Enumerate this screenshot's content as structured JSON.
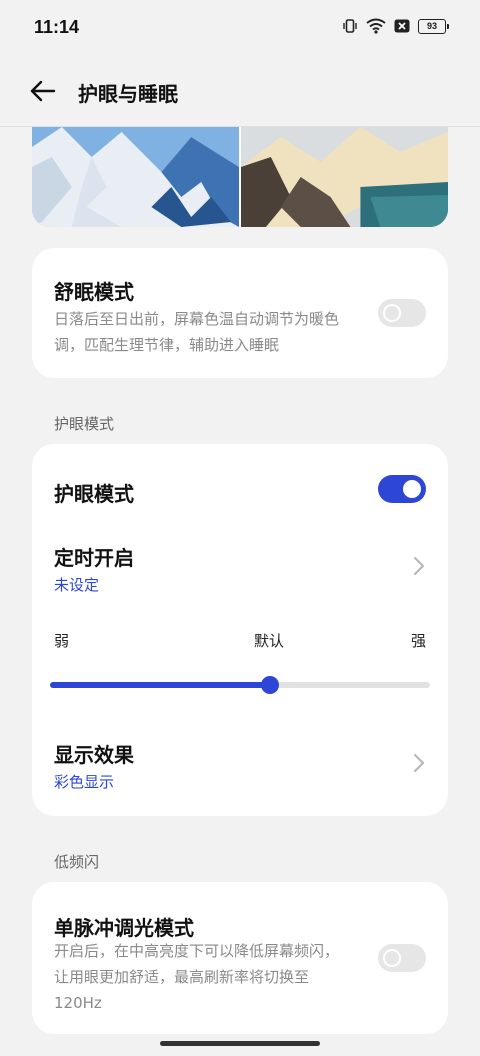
{
  "status_bar": {
    "time": "11:14",
    "battery": "93"
  },
  "header": {
    "title": "护眼与睡眠"
  },
  "sleep_card": {
    "title": "舒眠模式",
    "description_line1": "日落后至日出前，屏幕色温自动调节为暖色",
    "description_line2": "调，匹配生理节律，辅助进入睡眠",
    "toggle_on": false
  },
  "eye_section": {
    "label": "护眼模式",
    "eye_mode": {
      "title": "护眼模式",
      "toggle_on": true
    },
    "schedule": {
      "title": "定时开启",
      "value": "未设定"
    },
    "slider": {
      "min_label": "弱",
      "mid_label": "默认",
      "max_label": "强",
      "level_fraction": 0.58
    },
    "display": {
      "title": "显示效果",
      "value": "彩色显示"
    }
  },
  "flicker_section": {
    "label": "低频闪",
    "pulse_mode": {
      "title": "单脉冲调光模式",
      "description_line1": "开启后，在中高亮度下可以降低屏幕频闪，",
      "description_line2": "让用眼更加舒适，最高刷新率将切换至",
      "description_line3": "120Hz",
      "toggle_on": false
    }
  },
  "colors": {
    "accent": "#2e46d6",
    "background": "#f2f2f2",
    "card": "#ffffff"
  }
}
